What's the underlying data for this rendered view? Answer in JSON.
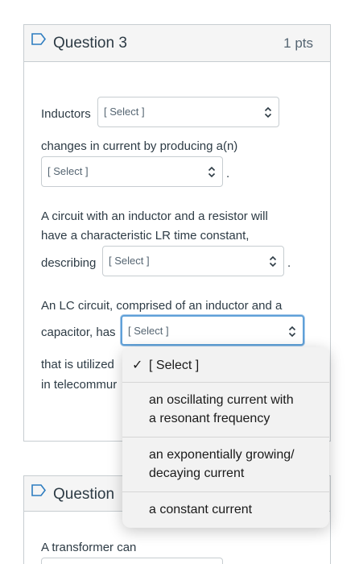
{
  "question3": {
    "title": "Question 3",
    "points": "1 pts",
    "part1_before": "Inductors",
    "select1": "[ Select ]",
    "part1_after": "changes in current by producing a(n)",
    "select2": "[ Select ]",
    "period": ".",
    "para2_line1": "A circuit with an inductor and a resistor will",
    "para2_line2": "have a characteristic LR time constant,",
    "para2_line3": "describing",
    "select3": "[ Select ]",
    "para3_line1": "An LC circuit, comprised of an inductor and a",
    "para3_line2": "capacitor, has",
    "select4": "[ Select ]",
    "para3_line3": "that is utilized",
    "para3_line4": "in telecommur"
  },
  "dropdown": {
    "checkmark": "✓",
    "selected": "[ Select ]",
    "option1_line1": "an oscillating current with",
    "option1_line2": "a resonant frequency",
    "option2_line1": "an exponentially growing/",
    "option2_line2": "decaying current",
    "option3": "a constant current"
  },
  "question4": {
    "title": "Question",
    "text": "A transformer can"
  }
}
